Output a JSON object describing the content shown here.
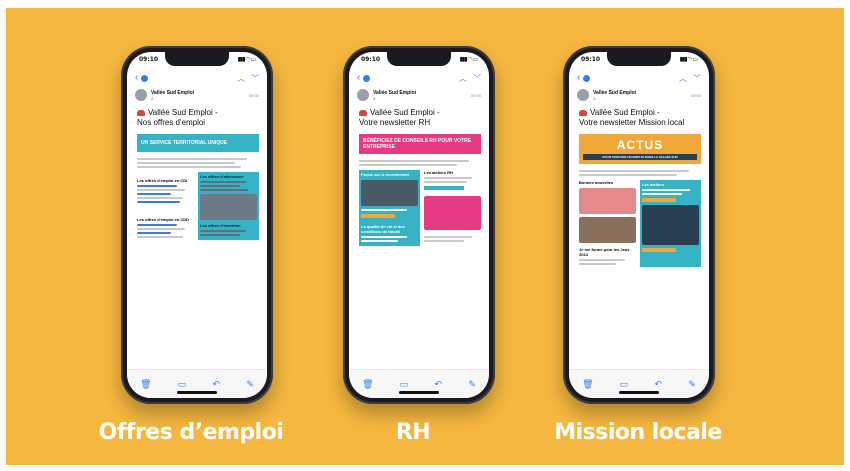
{
  "phones": [
    {
      "status_time": "09:10",
      "sender": "Vallée Sud Emploi",
      "recipient": "À :",
      "time": "09:00",
      "subject_line1": "Vallée Sud Emploi -",
      "subject_line2": "Nos offres d'emploi",
      "banner_text": "UN SERVICE TERRITORIAL UNIQUE",
      "left_heading1": "Les offres d'emploi en CDI",
      "left_heading2": "Les offres d'emploi en CDD",
      "right_heading1": "Les offres d'alternance",
      "right_heading2": "Les offres d'insertion",
      "caption": "Offres d’emploi"
    },
    {
      "status_time": "09:10",
      "sender": "Vallée Sud Emploi",
      "recipient": "À :",
      "time": "09:00",
      "subject_line1": "Vallée Sud Emploi -",
      "subject_line2": "Votre newsletter RH",
      "banner_text": "BÉNÉFICIEZ DE CONSEILS RH POUR VOTRE ENTREPRISE",
      "left_heading1": "Focus sur le recrutement",
      "right_heading1": "Les ateliers RH",
      "left_heading2": "La qualité de vie et des conditions de travail",
      "caption": "RH"
    },
    {
      "status_time": "09:10",
      "sender": "Vallée Sud Emploi",
      "recipient": "À :",
      "time": "09:00",
      "subject_line1": "Vallée Sud Emploi -",
      "subject_line2": "Votre newsletter Mission local",
      "banner_text": "ACTUS",
      "banner_sub": "POUR TROUVER UN EMPLOI DANS LA VALLÉE SUD",
      "left_heading1": "Bonnes nouvelles",
      "right_heading1": "Les ateliers",
      "left_heading2": "Je me forme pour les Jeux 2024",
      "caption": "Mission locale"
    }
  ],
  "colors": {
    "background": "#f5b73f",
    "teal": "#35b3c4",
    "pink": "#e63b84",
    "orange": "#f0a83a",
    "ios_blue": "#2f7cf6"
  },
  "icons": [
    "back-chevron-icon",
    "chevron-up-icon",
    "chevron-down-icon",
    "trash-icon",
    "folder-icon",
    "reply-icon",
    "compose-icon"
  ]
}
